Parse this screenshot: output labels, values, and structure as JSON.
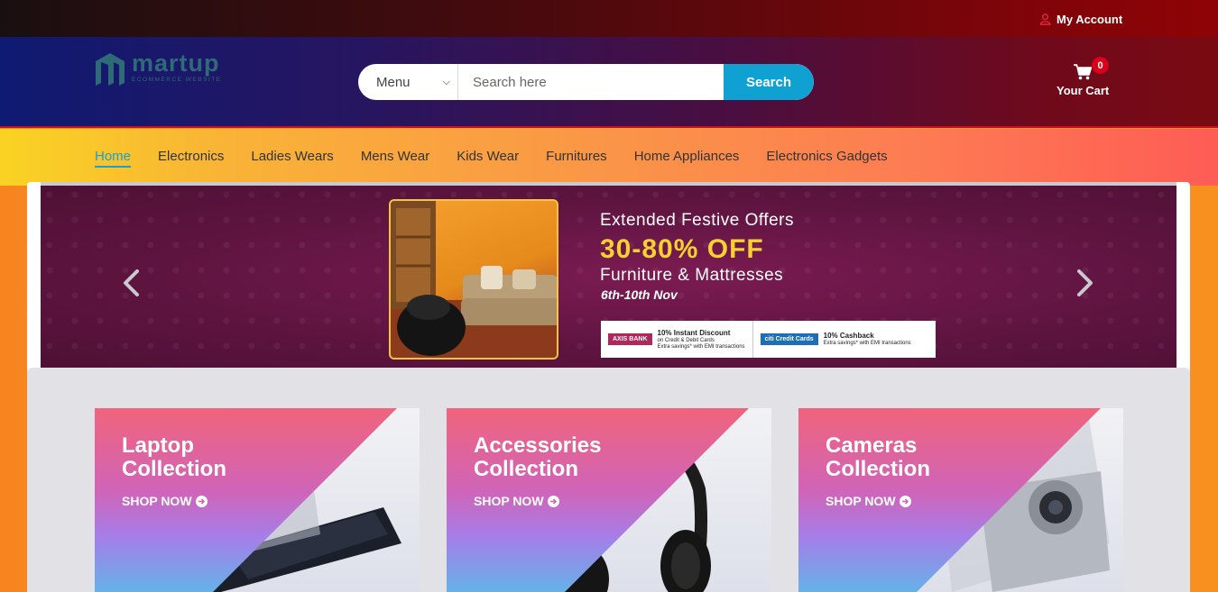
{
  "topbar": {
    "account_label": "My Account"
  },
  "header": {
    "logo_name": "martup",
    "logo_sub": "ECOMMERCE WEBSITE",
    "search_select": "Menu",
    "search_placeholder": "Search here",
    "search_button": "Search",
    "cart_count": "0",
    "cart_label": "Your Cart"
  },
  "nav": {
    "items": [
      {
        "label": "Home",
        "active": true
      },
      {
        "label": "Electronics"
      },
      {
        "label": "Ladies Wears"
      },
      {
        "label": "Mens Wear"
      },
      {
        "label": "Kids Wear"
      },
      {
        "label": "Furnitures"
      },
      {
        "label": "Home Appliances"
      },
      {
        "label": "Electronics Gadgets"
      }
    ]
  },
  "banner": {
    "title": "Extended Festive Offers",
    "discount": "30-80% OFF",
    "category": "Furniture & Mattresses",
    "date": "6th-10th Nov",
    "axis_logo": "AXIS BANK",
    "axis_offer": "10% Instant Discount",
    "axis_note1": "on Credit & Debit Cards",
    "axis_note2": "Extra savings* with EMI transactions",
    "citi_logo": "citi  Credit Cards",
    "citi_offer": "10% Cashback",
    "citi_note": "Extra savings* with EMI transactions"
  },
  "collections": [
    {
      "title_line1": "Laptop",
      "title_line2": "Collection",
      "cta": "SHOP NOW"
    },
    {
      "title_line1": "Accessories",
      "title_line2": "Collection",
      "cta": "SHOP NOW"
    },
    {
      "title_line1": "Cameras",
      "title_line2": "Collection",
      "cta": "SHOP NOW"
    }
  ],
  "colors": {
    "accent": "#0ea1d2",
    "badge": "#d8001a",
    "offer_yellow": "#f6d130"
  },
  "icons": [
    "user-icon",
    "cart-icon",
    "chevron-left-icon",
    "chevron-right-icon",
    "arrow-circle-right-icon",
    "logo-mark-icon"
  ]
}
